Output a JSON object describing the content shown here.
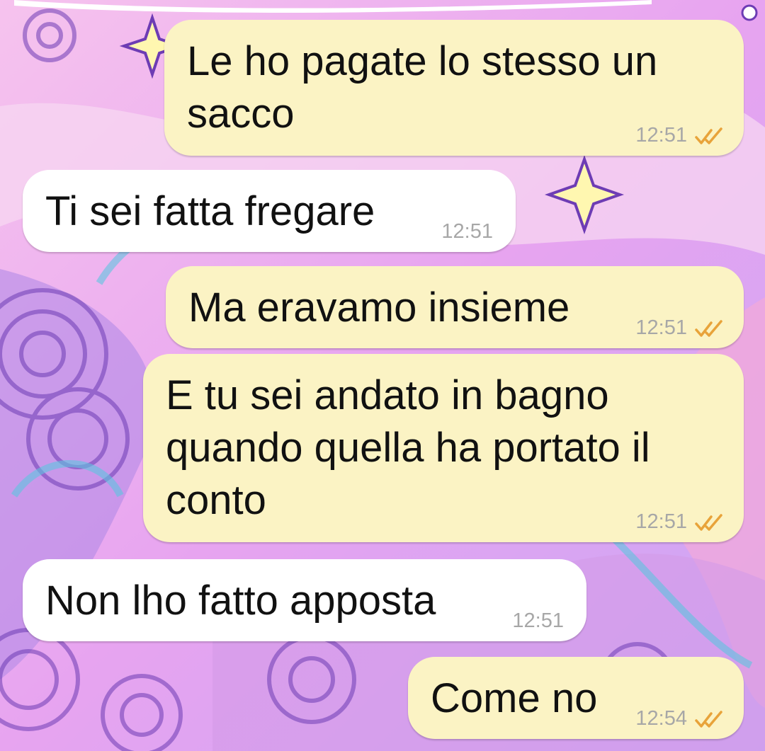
{
  "theme": {
    "outgoing_bubble": "#fbf3c4",
    "incoming_bubble": "#ffffff",
    "tick_color": "#e8a33a",
    "time_color": "#a7a7a7"
  },
  "messages": [
    {
      "direction": "out",
      "text": "Le ho pagate lo stesso un\nsacco",
      "time": "12:51",
      "status_icon": "double-check-icon"
    },
    {
      "direction": "in",
      "text": "Ti sei fatta fregare",
      "time": "12:51"
    },
    {
      "direction": "out",
      "text": "Ma eravamo insieme",
      "time": "12:51",
      "status_icon": "double-check-icon"
    },
    {
      "direction": "out",
      "text": "E tu sei andato in bagno\nquando quella ha portato il\nconto",
      "time": "12:51",
      "status_icon": "double-check-icon"
    },
    {
      "direction": "in",
      "text": "Non lho fatto apposta",
      "time": "12:51"
    },
    {
      "direction": "out",
      "text": "Come no",
      "time": "12:54",
      "status_icon": "double-check-icon"
    }
  ]
}
